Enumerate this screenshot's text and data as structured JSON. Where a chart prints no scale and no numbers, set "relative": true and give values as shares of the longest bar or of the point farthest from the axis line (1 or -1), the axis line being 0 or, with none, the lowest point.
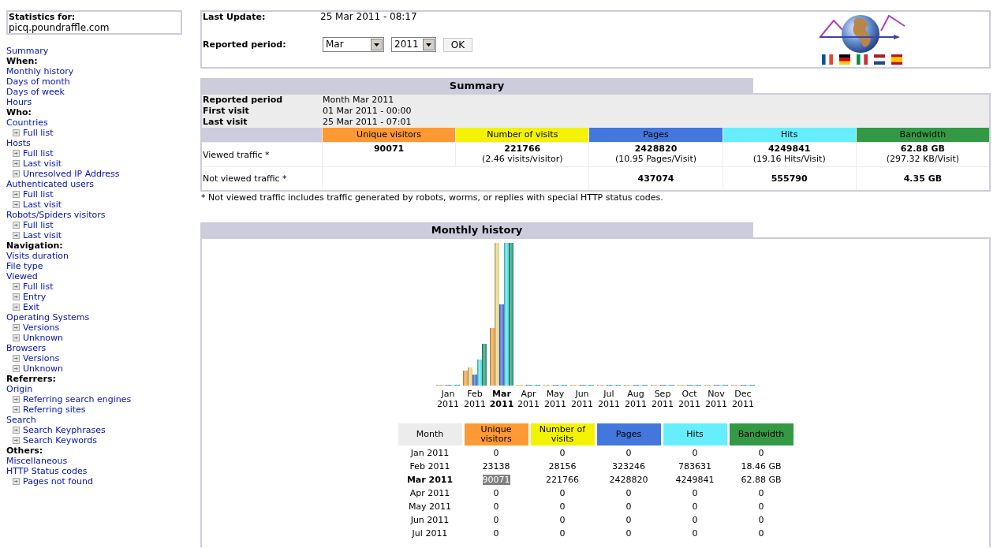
{
  "sidebar": {
    "site_box": {
      "label": "Statistics for:",
      "site": "picq.poundraffle.com"
    },
    "items": [
      {
        "kind": "link",
        "label": "Summary"
      },
      {
        "kind": "heading",
        "label": "When:"
      },
      {
        "kind": "link",
        "label": "Monthly history"
      },
      {
        "kind": "link",
        "label": "Days of month"
      },
      {
        "kind": "link",
        "label": "Days of week"
      },
      {
        "kind": "link",
        "label": "Hours"
      },
      {
        "kind": "heading",
        "label": "Who:"
      },
      {
        "kind": "link",
        "label": "Countries",
        "children": [
          {
            "label": "Full list"
          }
        ]
      },
      {
        "kind": "link",
        "label": "Hosts",
        "children": [
          {
            "label": "Full list"
          },
          {
            "label": "Last visit"
          },
          {
            "label": "Unresolved IP Address"
          }
        ]
      },
      {
        "kind": "link",
        "label": "Authenticated users",
        "children": [
          {
            "label": "Full list"
          },
          {
            "label": "Last visit"
          }
        ]
      },
      {
        "kind": "link",
        "label": "Robots/Spiders visitors",
        "children": [
          {
            "label": "Full list"
          },
          {
            "label": "Last visit"
          }
        ]
      },
      {
        "kind": "heading",
        "label": "Navigation:"
      },
      {
        "kind": "link",
        "label": "Visits duration"
      },
      {
        "kind": "link",
        "label": "File type"
      },
      {
        "kind": "link",
        "label": "Viewed",
        "children": [
          {
            "label": "Full list"
          },
          {
            "label": "Entry"
          },
          {
            "label": "Exit"
          }
        ]
      },
      {
        "kind": "link",
        "label": "Operating Systems",
        "children": [
          {
            "label": "Versions"
          },
          {
            "label": "Unknown"
          }
        ]
      },
      {
        "kind": "link",
        "label": "Browsers",
        "children": [
          {
            "label": "Versions"
          },
          {
            "label": "Unknown"
          }
        ]
      },
      {
        "kind": "heading",
        "label": "Referrers:"
      },
      {
        "kind": "link",
        "label": "Origin",
        "children": [
          {
            "label": "Referring search engines"
          },
          {
            "label": "Referring sites"
          }
        ]
      },
      {
        "kind": "link",
        "label": "Search",
        "children": [
          {
            "label": "Search Keyphrases"
          },
          {
            "label": "Search Keywords"
          }
        ]
      },
      {
        "kind": "heading",
        "label": "Others:"
      },
      {
        "kind": "link",
        "label": "Miscellaneous"
      },
      {
        "kind": "link",
        "label": "HTTP Status codes",
        "children": [
          {
            "label": "Pages not found"
          }
        ]
      }
    ]
  },
  "header": {
    "last_update": {
      "label": "Last Update:",
      "value": "25 Mar 2011 - 08:17"
    },
    "reported_period": {
      "label": "Reported period:",
      "month": "Mar",
      "year": "2011",
      "button": "OK"
    }
  },
  "summary": {
    "title": "Summary",
    "info": [
      {
        "label": "Reported period",
        "value": "Month Mar 2011"
      },
      {
        "label": "First visit",
        "value": "01 Mar 2011 - 00:00"
      },
      {
        "label": "Last visit",
        "value": "25 Mar 2011 - 07:01"
      }
    ],
    "columns": [
      {
        "label": "Unique visitors",
        "color": "#ff9933"
      },
      {
        "label": "Number of visits",
        "color": "#f3f300"
      },
      {
        "label": "Pages",
        "color": "#4477dd"
      },
      {
        "label": "Hits",
        "color": "#66eeff"
      },
      {
        "label": "Bandwidth",
        "color": "#339944"
      }
    ],
    "rows": [
      {
        "label": "Viewed traffic *",
        "cells": [
          {
            "value": "90071"
          },
          {
            "value": "221766",
            "detail": "(2.46 visits/visitor)"
          },
          {
            "value": "2428820",
            "detail": "(10.95 Pages/Visit)"
          },
          {
            "value": "4249841",
            "detail": "(19.16 Hits/Visit)"
          },
          {
            "value": "62.88 GB",
            "detail": "(297.32 KB/Visit)"
          }
        ]
      },
      {
        "label": "Not viewed traffic *",
        "cells": [
          {},
          {},
          {
            "value": "437074"
          },
          {
            "value": "555790"
          },
          {
            "value": "4.35 GB"
          }
        ]
      }
    ],
    "footnote": "* Not viewed traffic includes traffic generated by robots, worms, or replies with special HTTP status codes."
  },
  "monthly_history": {
    "title": "Monthly history",
    "chart_data": {
      "type": "bar",
      "relative": true,
      "categories": [
        "Jan 2011",
        "Feb 2011",
        "Mar 2011",
        "Apr 2011",
        "May 2011",
        "Jun 2011",
        "Jul 2011",
        "Aug 2011",
        "Sep 2011",
        "Oct 2011",
        "Nov 2011",
        "Dec 2011"
      ],
      "series": [
        {
          "color": "#f0a040",
          "values": [
            0,
            0.104,
            0.406,
            0,
            0,
            0,
            0,
            0,
            0,
            0,
            0,
            0
          ]
        },
        {
          "color": "#e2d27a",
          "values": [
            0,
            0.127,
            1,
            0,
            0,
            0,
            0,
            0,
            0,
            0,
            0,
            0
          ]
        },
        {
          "color": "#3f63d6",
          "values": [
            0,
            0.076,
            0.571,
            0,
            0,
            0,
            0,
            0,
            0,
            0,
            0,
            0
          ]
        },
        {
          "color": "#48dfe8",
          "values": [
            0,
            0.184,
            1,
            0,
            0,
            0,
            0,
            0,
            0,
            0,
            0,
            0
          ]
        },
        {
          "color": "#16906e",
          "values": [
            0,
            0.294,
            1,
            0,
            0,
            0,
            0,
            0,
            0,
            0,
            0,
            0
          ]
        }
      ]
    },
    "table": {
      "columns": [
        {
          "label": "Month",
          "color": "#ececec"
        },
        {
          "label": "Unique visitors",
          "color": "#ff9933"
        },
        {
          "label": "Number of visits",
          "color": "#f3f300"
        },
        {
          "label": "Pages",
          "color": "#4477dd"
        },
        {
          "label": "Hits",
          "color": "#66eeff"
        },
        {
          "label": "Bandwidth",
          "color": "#339944"
        }
      ],
      "rows": [
        {
          "selected": false,
          "cells": [
            {
              "text": "Jan 2011",
              "highlighted": false
            },
            {
              "text": "0",
              "highlighted": false
            },
            {
              "text": "0",
              "highlighted": false
            },
            {
              "text": "0",
              "highlighted": false
            },
            {
              "text": "0",
              "highlighted": false
            },
            {
              "text": "0",
              "highlighted": false
            }
          ]
        },
        {
          "selected": false,
          "cells": [
            {
              "text": "Feb 2011",
              "highlighted": false
            },
            {
              "text": "23138",
              "highlighted": false
            },
            {
              "text": "28156",
              "highlighted": false
            },
            {
              "text": "323246",
              "highlighted": false
            },
            {
              "text": "783631",
              "highlighted": false
            },
            {
              "text": "18.46 GB",
              "highlighted": false
            }
          ]
        },
        {
          "selected": true,
          "cells": [
            {
              "text": "Mar 2011",
              "highlighted": false
            },
            {
              "text": "90071",
              "highlighted": true
            },
            {
              "text": "221766",
              "highlighted": false
            },
            {
              "text": "2428820",
              "highlighted": false
            },
            {
              "text": "4249841",
              "highlighted": false
            },
            {
              "text": "62.88 GB",
              "highlighted": false
            }
          ]
        },
        {
          "selected": false,
          "cells": [
            {
              "text": "Apr 2011",
              "highlighted": false
            },
            {
              "text": "0",
              "highlighted": false
            },
            {
              "text": "0",
              "highlighted": false
            },
            {
              "text": "0",
              "highlighted": false
            },
            {
              "text": "0",
              "highlighted": false
            },
            {
              "text": "0",
              "highlighted": false
            }
          ]
        },
        {
          "selected": false,
          "cells": [
            {
              "text": "May 2011",
              "highlighted": false
            },
            {
              "text": "0",
              "highlighted": false
            },
            {
              "text": "0",
              "highlighted": false
            },
            {
              "text": "0",
              "highlighted": false
            },
            {
              "text": "0",
              "highlighted": false
            },
            {
              "text": "0",
              "highlighted": false
            }
          ]
        },
        {
          "selected": false,
          "cells": [
            {
              "text": "Jun 2011",
              "highlighted": false
            },
            {
              "text": "0",
              "highlighted": false
            },
            {
              "text": "0",
              "highlighted": false
            },
            {
              "text": "0",
              "highlighted": false
            },
            {
              "text": "0",
              "highlighted": false
            },
            {
              "text": "0",
              "highlighted": false
            }
          ]
        },
        {
          "selected": false,
          "cells": [
            {
              "text": "Jul 2011",
              "highlighted": false
            },
            {
              "text": "0",
              "highlighted": false
            },
            {
              "text": "0",
              "highlighted": false
            },
            {
              "text": "0",
              "highlighted": false
            },
            {
              "text": "0",
              "highlighted": false
            },
            {
              "text": "0",
              "highlighted": false
            }
          ]
        }
      ]
    }
  }
}
